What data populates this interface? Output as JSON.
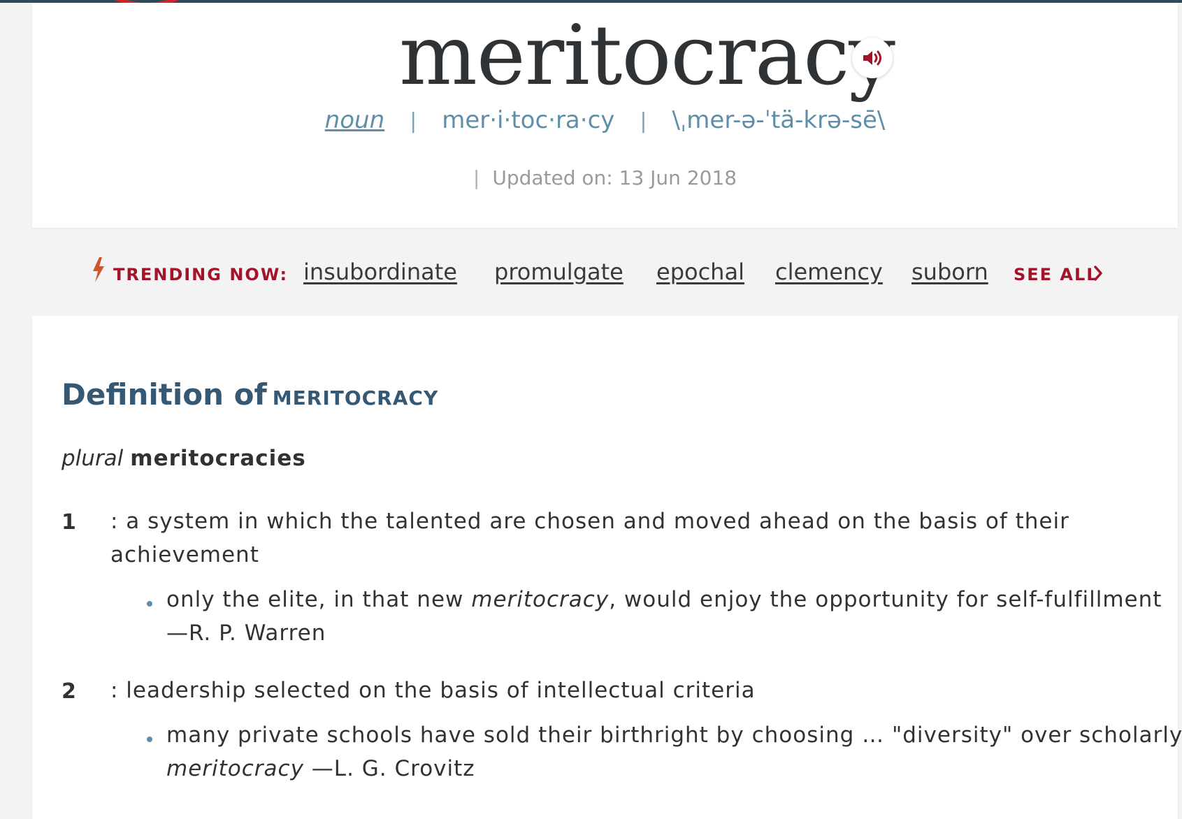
{
  "header": {
    "headword": "meritocracy",
    "part_of_speech": "noun",
    "syllabification": "mer·i·toc·ra·cy",
    "pronunciation": "\\ˌmer-ə-ˈtä-krə-sē\\",
    "separator": "|",
    "updated": "Updated on: 13 Jun 2018",
    "audio_icon": "speaker-icon"
  },
  "trending": {
    "label": "TRENDING NOW:",
    "icon": "lightning-icon",
    "words": [
      "insubordinate",
      "promulgate",
      "epochal",
      "clemency",
      "suborn"
    ],
    "see_all": "SEE ALL"
  },
  "definition": {
    "title": "Definition of",
    "title_word": "MERITOCRACY",
    "plural_label": "plural",
    "plural_form": "meritocracies",
    "senses": [
      {
        "number": "1",
        "text": ": a system in which the talented are chosen and moved ahead on the basis of their achievement",
        "example_before": "only the elite, in that new ",
        "example_italic": "meritocracy",
        "example_after": ", would enjoy the opportunity for self-fulfillment —R. P. Warren"
      },
      {
        "number": "2",
        "text": ": leadership selected on the basis of intellectual criteria",
        "example_before": "many private schools have sold their birthright by choosing … \"diversity\" over scholarly ",
        "example_italic": "meritocracy",
        "example_after": " —L. G. Crovitz"
      }
    ]
  },
  "colors": {
    "brand_red": "#a3142a",
    "link_blue": "#5f8fa8",
    "title_blue": "#365873",
    "text": "#303336"
  }
}
